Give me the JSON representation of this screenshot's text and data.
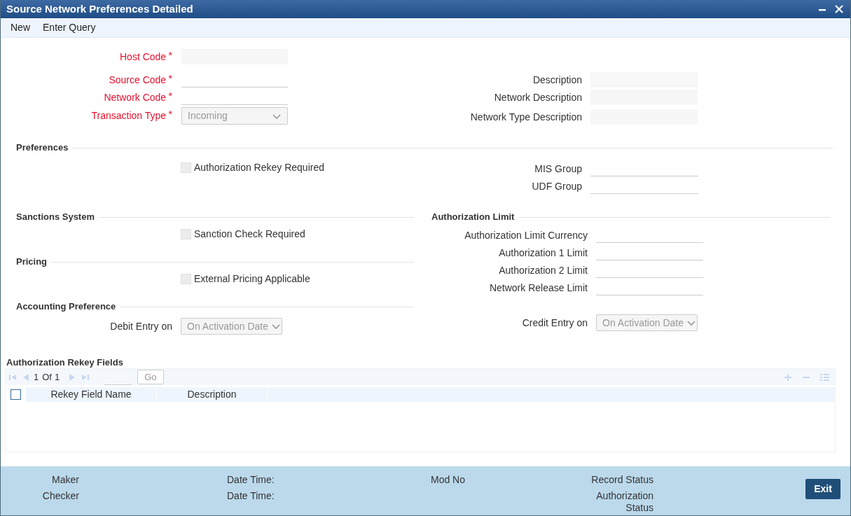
{
  "window": {
    "title": "Source Network Preferences Detailed"
  },
  "toolbar": [
    {
      "label": "New"
    },
    {
      "label": "Enter Query"
    }
  ],
  "header": {
    "left": [
      {
        "label": "Host Code",
        "required_mark": "*",
        "kind": "text",
        "disabled": true
      },
      {
        "label": "Source Code",
        "required_mark": "*",
        "kind": "text",
        "disabled": false
      },
      {
        "label": "Network Code",
        "required_mark": "*",
        "kind": "text",
        "disabled": false
      },
      {
        "label": "Transaction Type",
        "required_mark": "*",
        "kind": "select",
        "value": "Incoming",
        "disabled": true
      }
    ],
    "right": [
      {
        "label": "Description",
        "kind": "text",
        "disabled": true
      },
      {
        "label": "Network Description",
        "kind": "text",
        "disabled": true
      },
      {
        "label": "Network Type Description",
        "kind": "text",
        "disabled": true
      }
    ]
  },
  "preferences": {
    "title": "Preferences",
    "checkboxes": [
      {
        "label": "Authorization Rekey Required",
        "checked": false,
        "disabled": true
      }
    ],
    "fields": [
      {
        "label": "MIS Group",
        "kind": "text",
        "disabled": false
      },
      {
        "label": "UDF Group",
        "kind": "text",
        "disabled": false
      }
    ]
  },
  "sanctions_system": {
    "title": "Sanctions System",
    "checkboxes": [
      {
        "label": "Sanction Check Required",
        "checked": false,
        "disabled": true
      }
    ]
  },
  "pricing": {
    "title": "Pricing",
    "checkboxes": [
      {
        "label": "External Pricing Applicable",
        "checked": false,
        "disabled": true
      }
    ]
  },
  "accounting_preference": {
    "title": "Accounting Preference",
    "fields": [
      {
        "label": "Debit Entry on",
        "kind": "select",
        "value": "On Activation Date",
        "disabled": true
      }
    ]
  },
  "authorization_limit": {
    "title": "Authorization Limit",
    "fields": [
      {
        "label": "Authorization Limit Currency",
        "kind": "text",
        "disabled": false
      },
      {
        "label": "Authorization 1 Limit",
        "kind": "text",
        "disabled": false
      },
      {
        "label": "Authorization 2 Limit",
        "kind": "text",
        "disabled": false
      },
      {
        "label": "Network Release Limit",
        "kind": "text",
        "disabled": false
      }
    ],
    "entry_fields": [
      {
        "label": "Credit Entry on",
        "kind": "select",
        "value": "On Activation Date",
        "disabled": true
      }
    ]
  },
  "rekey_fields": {
    "title": "Authorization Rekey Fields",
    "pager": {
      "page": "1",
      "of_label": "Of",
      "total": "1",
      "go_button": "Go"
    },
    "select_all_checked": false,
    "columns": [
      "Rekey Field Name",
      "Description"
    ]
  },
  "footer": {
    "rows": [
      [
        "Maker",
        "Date Time:",
        "Mod No",
        "Record Status"
      ],
      [
        "Checker",
        "Date Time:",
        "",
        "Authorization Status"
      ]
    ],
    "exit_button": "Exit"
  }
}
